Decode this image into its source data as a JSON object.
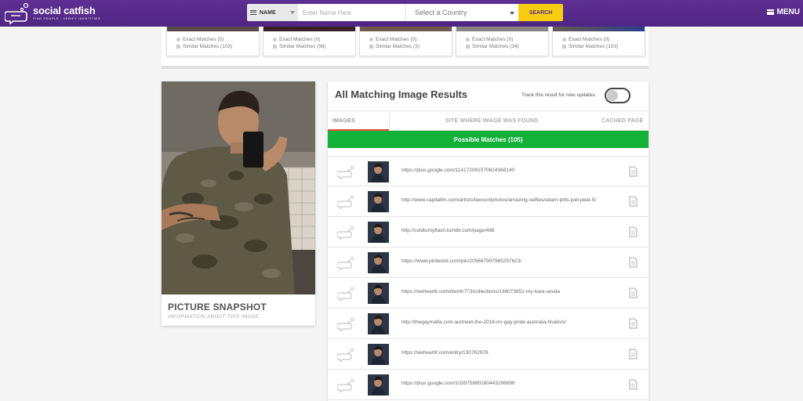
{
  "header": {
    "logo_name": "social catfish",
    "logo_tagline": "FIND PEOPLE · VERIFY IDENTITIES",
    "search_type": "NAME",
    "search_name_placeholder": "Enter Name Here",
    "country_placeholder": "Select a Country",
    "search_button": "SEARCH",
    "menu_label": "MENU"
  },
  "summary_cards": [
    {
      "exact": "Exact Matches (0)",
      "similar": "Similar Matches (103)"
    },
    {
      "exact": "Exact Matches (0)",
      "similar": "Similar Matches (98)"
    },
    {
      "exact": "Exact Matches (0)",
      "similar": "Similar Matches (3)"
    },
    {
      "exact": "Exact Matches (0)",
      "similar": "Similar Matches (34)"
    },
    {
      "exact": "Exact Matches (0)",
      "similar": "Similar Matches (103)"
    }
  ],
  "profile": {
    "title": "PICTURE SNAPSHOT",
    "subtitle": "INFORMATION ABOUT THIS IMAGE"
  },
  "results": {
    "title": "All Matching Image Results",
    "track_label": "Track this result for new updates",
    "track_enabled": false,
    "tabs": [
      "IMAGES",
      "SITE WHERE IMAGE WAS FOUND",
      "CACHED PAGE"
    ],
    "banner": "Possible Matches (105)",
    "items": [
      {
        "url": "https://plus.google.com/114172081570624368140"
      },
      {
        "url": "http://www.capitalfm.com/artists/lawson/photos/amazing-selfies/adam-pitts-joel-peat-5/"
      },
      {
        "url": "http://coldtomyflash.tumblr.com/page/498"
      },
      {
        "url": "https://www.pinterest.com/pin/205687907965297623/"
      },
      {
        "url": "https://weheartit.com/diamh773/collections/138073851-my-kara-sevda"
      },
      {
        "url": "http://thegaymafia.com.au/meet-the-2018-mr-gay-pride-australia-finalists/"
      },
      {
        "url": "https://weheartit.com/entry/130762976"
      },
      {
        "url": "https://plus.google.com/103975880180443296696"
      }
    ]
  },
  "colors": {
    "header_purple": "#5b2d8e",
    "search_yellow": "#f7cd12",
    "banner_green": "#12b13a",
    "tab_active_red": "#e74c3c"
  }
}
